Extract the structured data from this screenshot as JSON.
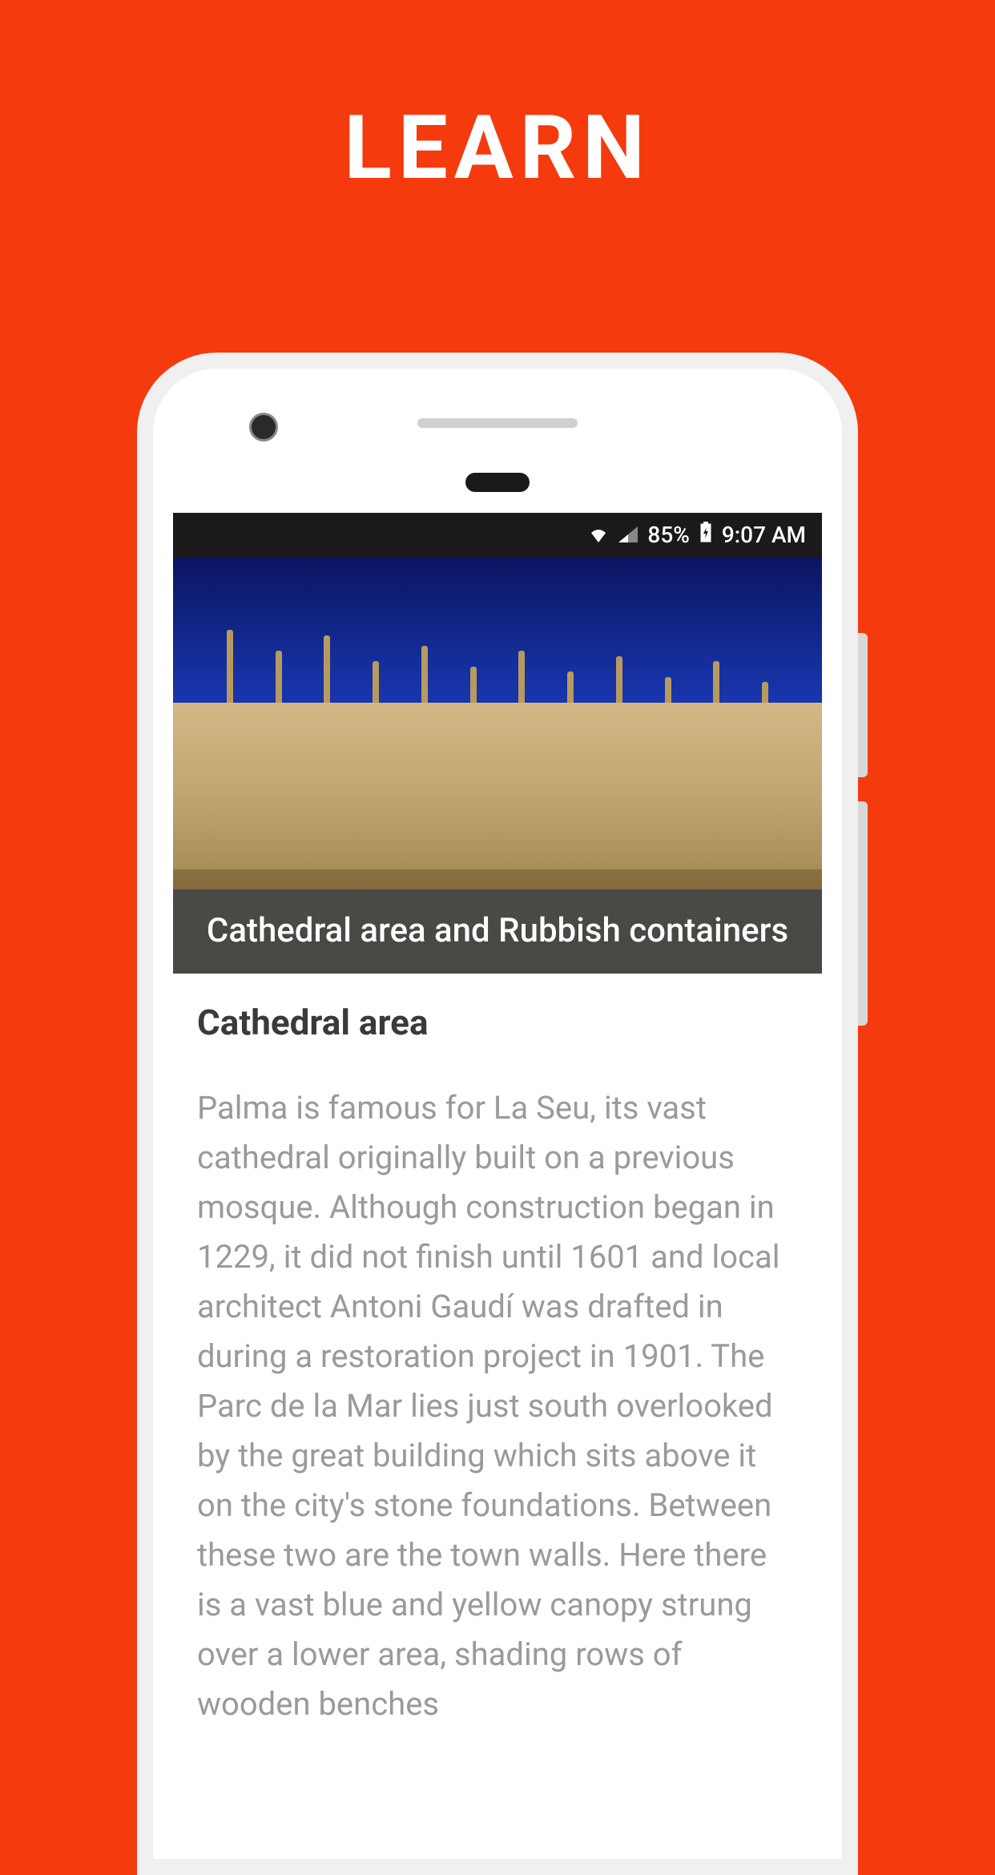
{
  "page": {
    "title": "LEARN"
  },
  "statusBar": {
    "battery": "85%",
    "time": "9:07 AM"
  },
  "hero": {
    "caption": "Cathedral area and Rubbish containers"
  },
  "article": {
    "sectionTitle": "Cathedral area",
    "body": "Palma is famous for La Seu, its vast cathedral originally built on a previous mosque. Although construction began in 1229, it did not finish until 1601 and local architect Antoni Gaudí was drafted in during a restoration project in 1901. The Parc de la Mar  lies just south overlooked by the great building which sits above it on the city's stone foundations. Between these two are the town walls. Here there is a vast blue and yellow canopy strung over a lower area, shading rows of wooden benches"
  }
}
